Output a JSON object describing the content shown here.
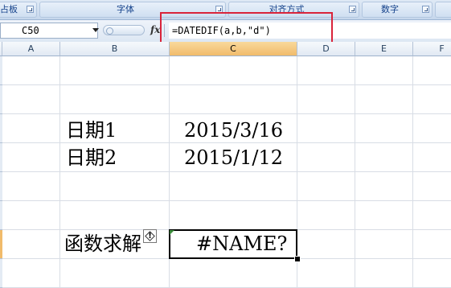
{
  "ribbon": {
    "groups": [
      {
        "label": "占板"
      },
      {
        "label": "字体"
      },
      {
        "label": "对齐方式"
      },
      {
        "label": "数字"
      },
      {
        "label": ""
      }
    ]
  },
  "formula_bar": {
    "name_box": "C50",
    "fx_label": "fx",
    "formula": "=DATEDIF(a,b,\"d\")"
  },
  "columns": [
    "A",
    "B",
    "C",
    "D",
    "E",
    "F"
  ],
  "selected_column": "C",
  "cells": {
    "b_date1_label": "日期1",
    "c_date1_value": "2015/3/16",
    "b_date2_label": "日期2",
    "c_date2_value": "2015/1/12",
    "b_func_label": "函数求解",
    "c_result": "#NAME?"
  },
  "error_icon": {
    "glyph": "!"
  },
  "colors": {
    "highlight_border": "#d9243a",
    "selected_header": "#f1bb6b",
    "error_marker": "#3a8a3a"
  }
}
